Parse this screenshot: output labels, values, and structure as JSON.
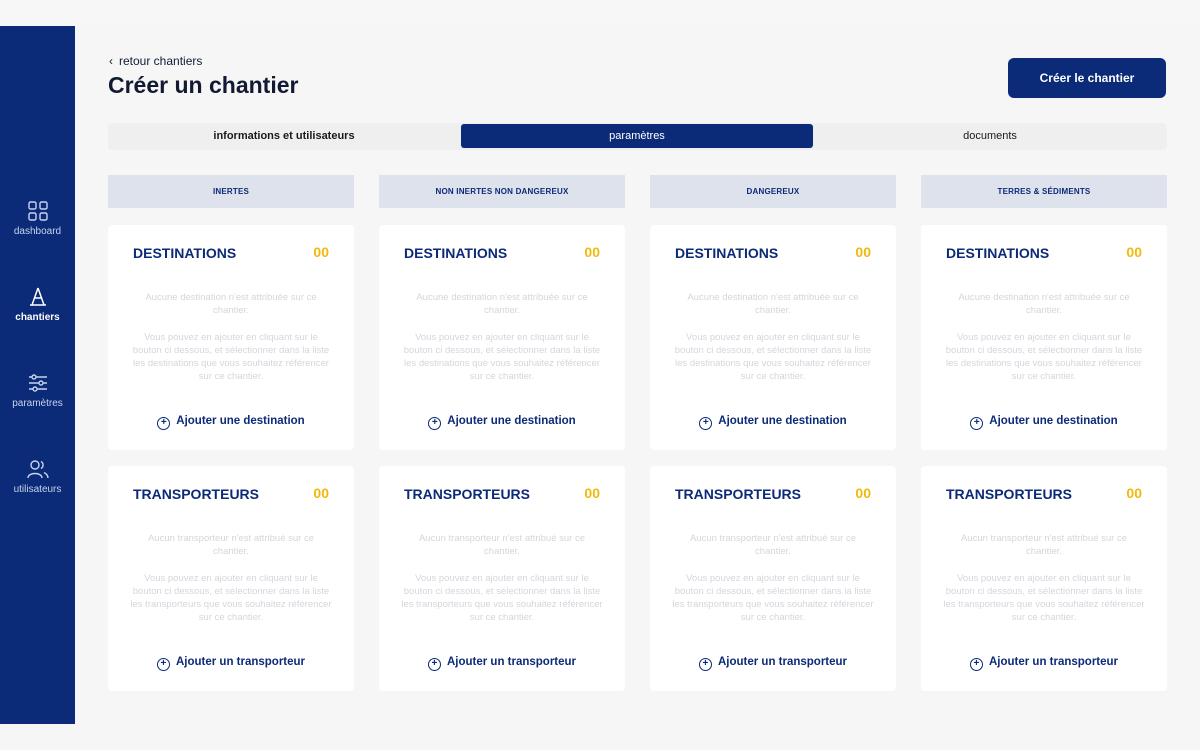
{
  "sidebar": {
    "items": [
      {
        "label": "dashboard",
        "icon": "grid-icon",
        "active": false
      },
      {
        "label": "chantiers",
        "icon": "cone-icon",
        "active": true
      },
      {
        "label": "paramètres",
        "icon": "sliders-icon",
        "active": false
      },
      {
        "label": "utilisateurs",
        "icon": "users-icon",
        "active": false
      }
    ]
  },
  "header": {
    "back_label": "retour chantiers",
    "title": "Créer un chantier",
    "create_button": "Créer le chantier"
  },
  "tabs": [
    {
      "label": "informations et utilisateurs",
      "active": false
    },
    {
      "label": "paramètres",
      "active": true
    },
    {
      "label": "documents",
      "active": false
    }
  ],
  "columns": [
    {
      "header": "INERTES"
    },
    {
      "header": "NON INERTES NON DANGEREUX"
    },
    {
      "header": "DANGEREUX"
    },
    {
      "header": "TERRES & SÉDIMENTS"
    }
  ],
  "destinations": {
    "title": "DESTINATIONS",
    "count": "00",
    "empty_line1": "Aucune destination n'est attribuée sur ce chantier.",
    "empty_line2": "Vous pouvez en ajouter en cliquant sur le bouton ci dessous, et sélectionner dans la liste les destinations que vous souhaitez référencer sur ce chantier.",
    "add_label": "Ajouter une destination"
  },
  "transporteurs": {
    "title": "TRANSPORTEURS",
    "count": "00",
    "empty_line1": "Aucun transporteur n'est attribué sur ce chantier.",
    "empty_line2": "Vous pouvez en ajouter en cliquant sur le bouton ci dessous, et sélectionner dans la liste les transporteurs que vous souhaitez référencer sur ce chantier.",
    "add_label": "Ajouter un transporteur"
  },
  "colors": {
    "primary": "#0b2a78",
    "accent": "#f2b90c",
    "header_bg": "#dde2ec"
  }
}
